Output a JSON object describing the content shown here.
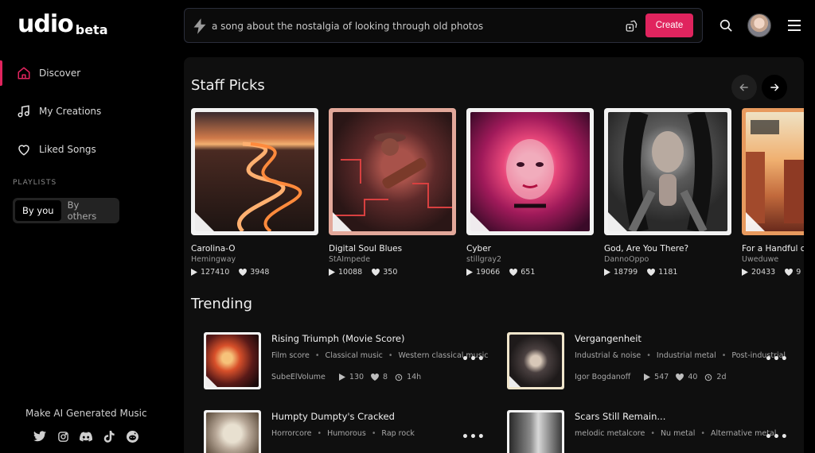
{
  "brand": {
    "name": "udio",
    "suffix": "beta"
  },
  "sidebar": {
    "items": [
      {
        "label": "Discover",
        "icon": "home-icon"
      },
      {
        "label": "My Creations",
        "icon": "music-note-icon"
      },
      {
        "label": "Liked Songs",
        "icon": "heart-icon"
      }
    ],
    "playlists_label": "PLAYLISTS",
    "playlist_filters": [
      "By you",
      "By others"
    ],
    "footer_text": "Make AI Generated Music",
    "socials": [
      "twitter-icon",
      "instagram-icon",
      "discord-icon",
      "tiktok-icon",
      "reddit-icon"
    ]
  },
  "search": {
    "placeholder": "a song about the nostalgia of looking through old photos",
    "create_label": "Create"
  },
  "staff_picks": {
    "title": "Staff Picks",
    "cards": [
      {
        "title": "Carolina-O",
        "artist": "Hemingway",
        "plays": "127410",
        "likes": "3948"
      },
      {
        "title": "Digital Soul Blues",
        "artist": "StAImpede",
        "plays": "10088",
        "likes": "350"
      },
      {
        "title": "Cyber",
        "artist": "stillgray2",
        "plays": "19066",
        "likes": "651"
      },
      {
        "title": "God, Are You There?",
        "artist": "DannoOppo",
        "plays": "18799",
        "likes": "1181"
      },
      {
        "title": "For a Handful c",
        "artist": "Uweduwe",
        "plays": "20433",
        "likes": "9"
      }
    ]
  },
  "trending": {
    "title": "Trending",
    "rows": [
      {
        "title": "Rising Triumph (Movie Score)",
        "tags": [
          "Film score",
          "Classical music",
          "Western classical music"
        ],
        "artist": "SubeElVolume",
        "plays": "130",
        "likes": "8",
        "age": "14h"
      },
      {
        "title": "Vergangenheit",
        "tags": [
          "Industrial & noise",
          "Industrial metal",
          "Post-industrial"
        ],
        "artist": "Igor Bogdanoff",
        "plays": "547",
        "likes": "40",
        "age": "2d"
      },
      {
        "title": "Humpty Dumpty's Cracked",
        "tags": [
          "Horrorcore",
          "Humorous",
          "Rap rock"
        ],
        "artist": "",
        "plays": "",
        "likes": "",
        "age": ""
      },
      {
        "title": "Scars Still Remain...",
        "tags": [
          "melodic metalcore",
          "Nu metal",
          "Alternative metal"
        ],
        "artist": "",
        "plays": "",
        "likes": "",
        "age": ""
      }
    ]
  },
  "colors": {
    "accent": "#e0245e",
    "background": "#000000",
    "panel": "#0f0f0f"
  }
}
